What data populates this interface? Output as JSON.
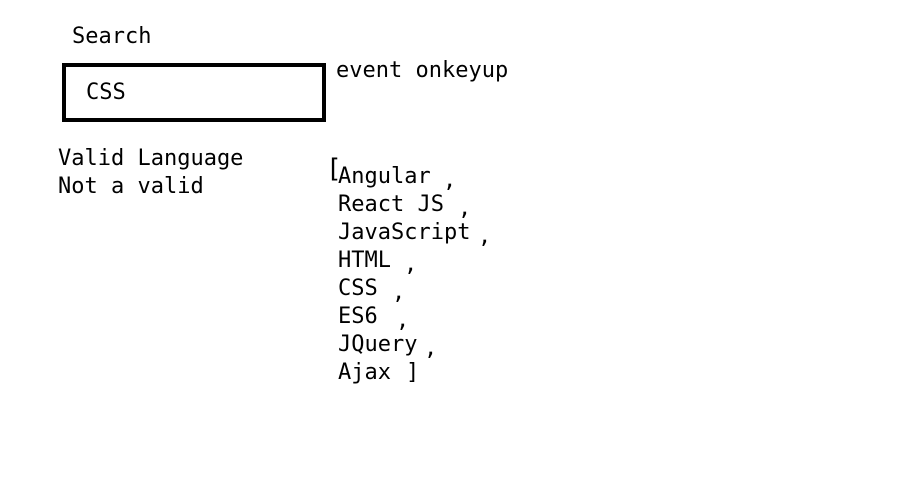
{
  "search": {
    "label": "Search",
    "value": "CSS"
  },
  "event_label": "event onkeyup",
  "results": {
    "valid": "Valid Language",
    "invalid": "Not a valid"
  },
  "array": {
    "open": "[",
    "close": "]",
    "separator": ",",
    "items": [
      "Angular",
      "React JS",
      "JavaScript",
      "HTML",
      "CSS",
      "ES6",
      "JQuery",
      "Ajax"
    ]
  }
}
